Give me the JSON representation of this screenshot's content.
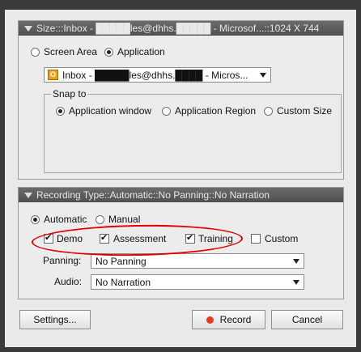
{
  "size_panel": {
    "header": "Size:::Inbox - █████les@dhhs.█████ - Microsof...::1024 X 744",
    "screen_area_label": "Screen Area",
    "application_label": "Application",
    "selected_mode": "Application",
    "app_dropdown_value": "Inbox - █████les@dhhs.████ - Micros...",
    "app_icon_letter": "O",
    "snap_to": {
      "title": "Snap to",
      "options": [
        "Application window",
        "Application Region",
        "Custom Size"
      ],
      "selected": "Application window"
    }
  },
  "recording_panel": {
    "header": "Recording Type::Automatic::No Panning::No Narration",
    "automatic_label": "Automatic",
    "manual_label": "Manual",
    "selected_type": "Automatic",
    "checkboxes": [
      {
        "label": "Demo",
        "checked": true
      },
      {
        "label": "Assessment",
        "checked": true
      },
      {
        "label": "Training",
        "checked": true
      },
      {
        "label": "Custom",
        "checked": false
      }
    ],
    "panning_label": "Panning:",
    "panning_value": "No Panning",
    "audio_label": "Audio:",
    "audio_value": "No Narration"
  },
  "buttons": {
    "settings": "Settings...",
    "record": "Record",
    "cancel": "Cancel"
  },
  "colors": {
    "annotation": "#e00000",
    "record_dot": "#e8371e",
    "header_bg": "#5a5a5a"
  }
}
